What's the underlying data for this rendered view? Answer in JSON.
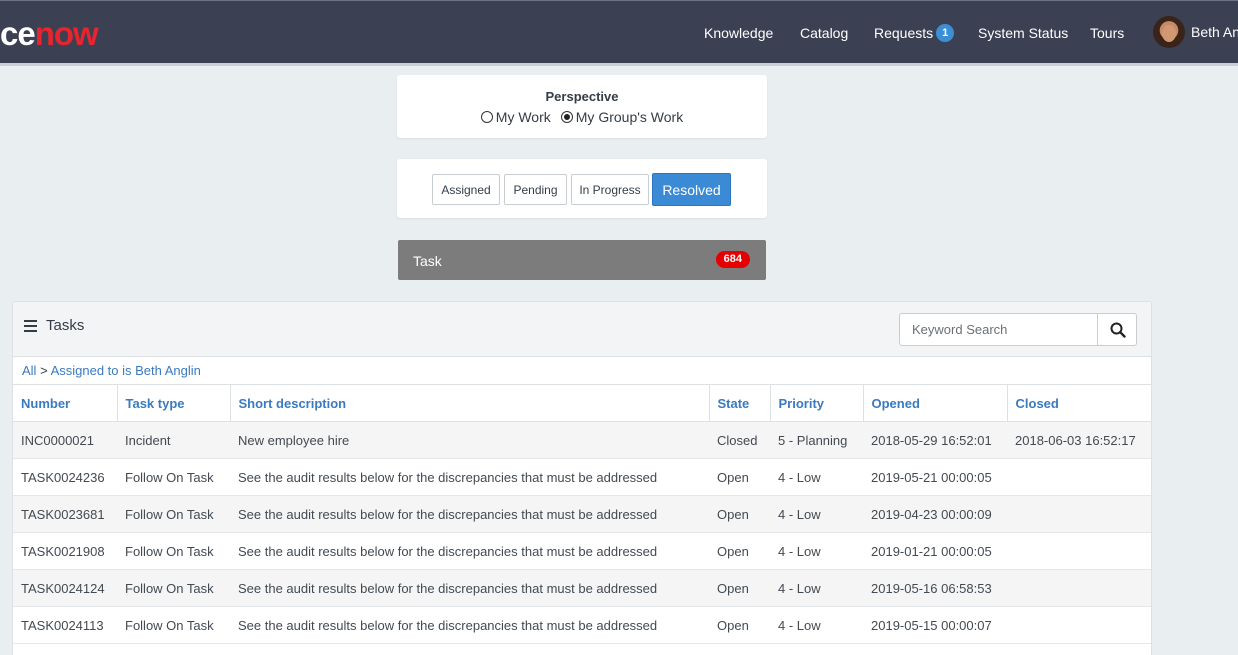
{
  "header": {
    "logo_prefix": "ce",
    "logo_suffix": "now",
    "nav": [
      {
        "label": "Knowledge"
      },
      {
        "label": "Catalog"
      },
      {
        "label": "Requests",
        "badge": "1"
      },
      {
        "label": "System Status"
      },
      {
        "label": "Tours"
      }
    ],
    "user_name": "Beth Anglin"
  },
  "perspective": {
    "title": "Perspective",
    "options": [
      {
        "label": "My Work",
        "selected": false
      },
      {
        "label": "My Group's Work",
        "selected": true
      }
    ]
  },
  "filters": {
    "buttons": [
      {
        "label": "Assigned",
        "active": false
      },
      {
        "label": "Pending",
        "active": false
      },
      {
        "label": "In Progress",
        "active": false
      },
      {
        "label": "Resolved",
        "active": true
      }
    ]
  },
  "task_bar": {
    "label": "Task",
    "count": "684"
  },
  "list": {
    "title": "Tasks",
    "search_placeholder": "Keyword Search",
    "breadcrumb": {
      "root": "All",
      "separator": ">",
      "filter": "Assigned to is Beth Anglin"
    },
    "columns": [
      "Number",
      "Task type",
      "Short description",
      "State",
      "Priority",
      "Opened",
      "Closed"
    ],
    "rows": [
      [
        "INC0000021",
        "Incident",
        "New employee hire",
        "Closed",
        "5 - Planning",
        "2018-05-29 16:52:01",
        "2018-06-03 16:52:17"
      ],
      [
        "TASK0024236",
        "Follow On Task",
        "See the audit results below for the discrepancies that must be addressed",
        "Open",
        "4 - Low",
        "2019-05-21 00:00:05",
        ""
      ],
      [
        "TASK0023681",
        "Follow On Task",
        "See the audit results below for the discrepancies that must be addressed",
        "Open",
        "4 - Low",
        "2019-04-23 00:00:09",
        ""
      ],
      [
        "TASK0021908",
        "Follow On Task",
        "See the audit results below for the discrepancies that must be addressed",
        "Open",
        "4 - Low",
        "2019-01-21 00:00:05",
        ""
      ],
      [
        "TASK0024124",
        "Follow On Task",
        "See the audit results below for the discrepancies that must be addressed",
        "Open",
        "4 - Low",
        "2019-05-16 06:58:53",
        ""
      ],
      [
        "TASK0024113",
        "Follow On Task",
        "See the audit results below for the discrepancies that must be addressed",
        "Open",
        "4 - Low",
        "2019-05-15 00:00:07",
        ""
      ]
    ]
  },
  "colors": {
    "header_bg": "#3b4153",
    "accent_blue": "#3a8ad6",
    "link_blue": "#3a7bbf",
    "badge_red": "#e60000",
    "logo_red": "#e8242f"
  }
}
